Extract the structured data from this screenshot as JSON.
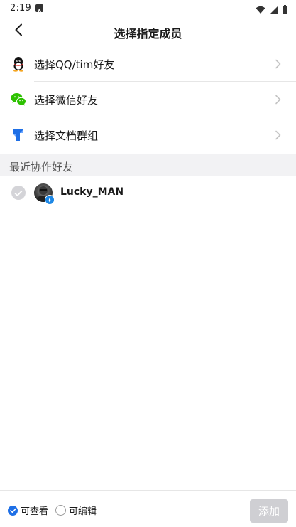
{
  "status_bar": {
    "time": "2:19",
    "icons": [
      "notification-a-icon",
      "wifi-icon",
      "signal-icon",
      "battery-icon"
    ]
  },
  "header": {
    "title": "选择指定成员",
    "back_icon": "back-arrow-icon"
  },
  "options": [
    {
      "label": "选择QQ/tim好友",
      "icon": "qq-penguin-icon"
    },
    {
      "label": "选择微信好友",
      "icon": "wechat-icon"
    },
    {
      "label": "选择文档群组",
      "icon": "docs-group-icon"
    }
  ],
  "recent": {
    "section_title": "最近协作好友",
    "friends": [
      {
        "name": "Lucky_MAN",
        "selected": false
      }
    ]
  },
  "bottom": {
    "permissions": [
      {
        "label": "可查看",
        "checked": true
      },
      {
        "label": "可编辑",
        "checked": false
      }
    ],
    "add_label": "添加"
  },
  "colors": {
    "accent": "#1e6fe6",
    "disabled_button": "#cfcfd3",
    "section_bg": "#f2f2f4",
    "wechat_green": "#2dc100"
  }
}
